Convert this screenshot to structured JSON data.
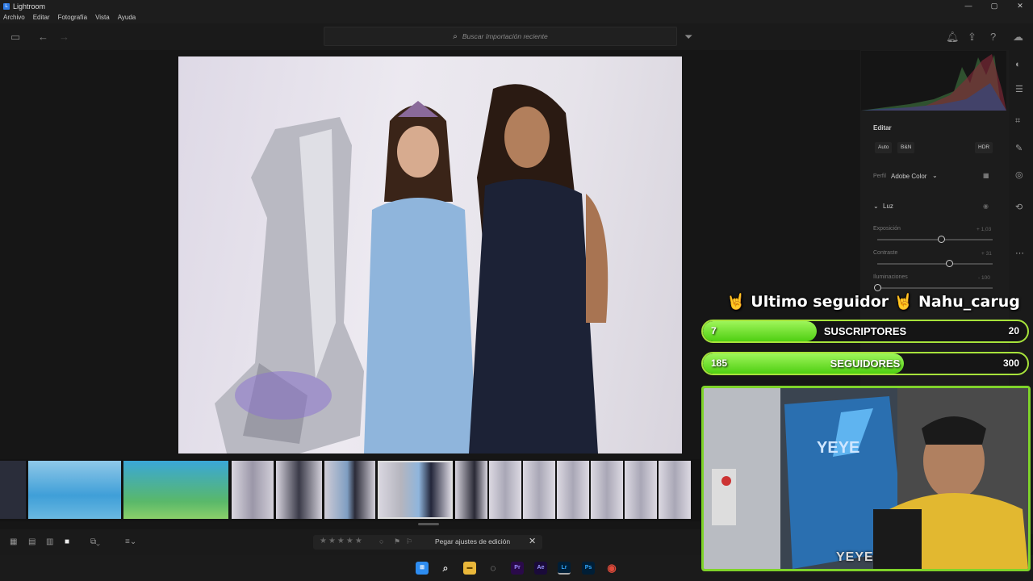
{
  "window": {
    "title": "Lightroom",
    "controls": [
      "—",
      "▢",
      "✕"
    ]
  },
  "menu": [
    "Archivo",
    "Editar",
    "Fotografía",
    "Vista",
    "Ayuda"
  ],
  "search": {
    "placeholder": "Buscar Importación reciente"
  },
  "edit_panel": {
    "title": "Editar",
    "buttons": {
      "auto": "Auto",
      "bw": "B&N",
      "hdr": "HDR"
    },
    "profile_label": "Perfil",
    "profile_value": "Adobe Color",
    "section": "Luz",
    "sliders": [
      {
        "label": "Exposición",
        "value_text": "+ 1,03",
        "level": 0.55
      },
      {
        "label": "Contraste",
        "value_text": "+ 31",
        "level": 0.62
      },
      {
        "label": "Iluminaciones",
        "value_text": "- 100",
        "level": 0.0
      }
    ]
  },
  "bottom": {
    "paste_label": "Pegar ajustes de edición",
    "stars": "★★★★★"
  },
  "overlay": {
    "follower_text": "🤘 Ultimo seguidor 🤘 Nahu_carug",
    "subs_label": "SUSCRIPTORES",
    "subs_current": "7",
    "subs_goal": "20",
    "subs_progress": 0.35,
    "followers_label": "SEGUIDORES",
    "followers_current": "185",
    "followers_goal": "300",
    "followers_progress": 0.62,
    "cam_label": "YEYE",
    "wall_text": "YEYE"
  },
  "taskbar": [
    "Pr",
    "Ae",
    "Lr",
    "Ps"
  ],
  "colors": {
    "overlay_green": "#7fd32a",
    "lightroom_blue": "#31a8ff"
  }
}
